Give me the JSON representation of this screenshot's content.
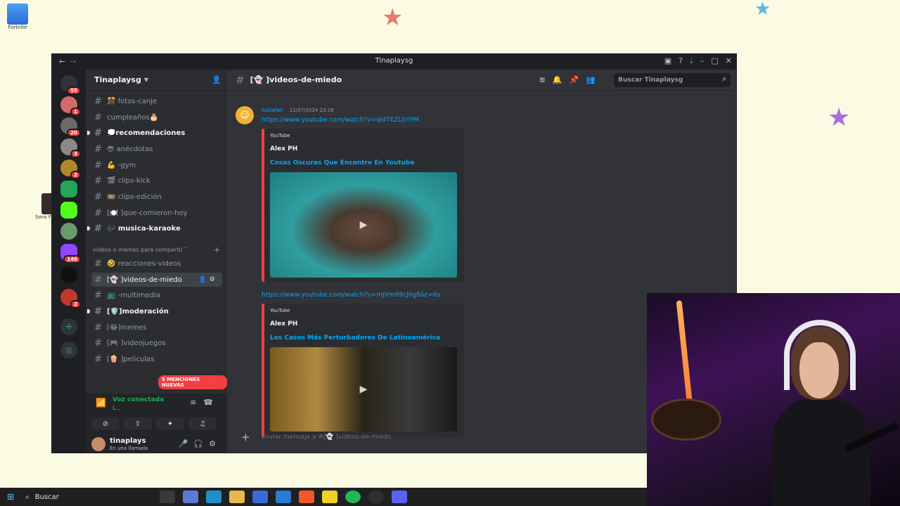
{
  "desktop": {
    "icon_label": "Fortnite",
    "icon_label_2": "Sons Forest"
  },
  "window": {
    "title": "Tinaplaysg"
  },
  "guilds": {
    "badges": [
      "55",
      "1",
      "20",
      "3",
      "2",
      "146",
      "2"
    ]
  },
  "server": {
    "name": "Tinaplaysg"
  },
  "channels": {
    "items": [
      {
        "label": "🎊 fotos-canje"
      },
      {
        "label": "cumpleaños🎂"
      },
      {
        "label": "💭recomendaciones"
      },
      {
        "label": "😎 anécdotas"
      },
      {
        "label": "💪 -gym"
      },
      {
        "label": "🎬 clips-kick"
      },
      {
        "label": "🎞️ clips-edición"
      },
      {
        "label": "[🍽️ ]que-comieron-hoy"
      },
      {
        "label": "🎶 musica-karaoke"
      },
      {
        "label": "🤣 reacciones-videos"
      },
      {
        "label": "[👻 ]videos-de-miedo"
      },
      {
        "label": "📺 -multimedia"
      },
      {
        "label": "[🛡️]moderación"
      },
      {
        "label": "[😂]memes"
      },
      {
        "label": "[🎮 ]videojuegos"
      },
      {
        "label": "[🍿 ]peliculas"
      }
    ],
    "category": "videos o memes para compartir"
  },
  "mentions_badge": "5 MENCIONES NUEVAS",
  "voice": {
    "status": "Voz conectada",
    "sub": "L..."
  },
  "user": {
    "name": "tinaplays",
    "status": "En una llamada"
  },
  "chat": {
    "channel_name": "[👻 ]videos-de-miedo",
    "search_placeholder": "Buscar Tinaplaysg",
    "input_placeholder": "Enviar mensaje a #[👻 ]videos-de-miedo"
  },
  "message": {
    "author": "luzialan",
    "timestamp": "21/07/2024 23:16",
    "link1": "https://www.youtube.com/watch?v=ql4TEZLbYPM",
    "embed1": {
      "provider": "YouTube",
      "author": "Alex PH",
      "title": "Cosas Oscuras Que Encontre En Youtube"
    },
    "link2": "https://www.youtube.com/watch?v=mJVm99cJ6g8&t=6s",
    "embed2": {
      "provider": "YouTube",
      "author": "Alex PH",
      "title": "Los Casos Más Perturbadores De Latinoamérica"
    }
  },
  "taskbar": {
    "search": "Buscar"
  },
  "colors": {
    "discord_bg": "#313338",
    "sidebar_bg": "#2b2d31",
    "link": "#00a8fc",
    "embed_border": "#f23f43",
    "voice_green": "#23a55a"
  }
}
